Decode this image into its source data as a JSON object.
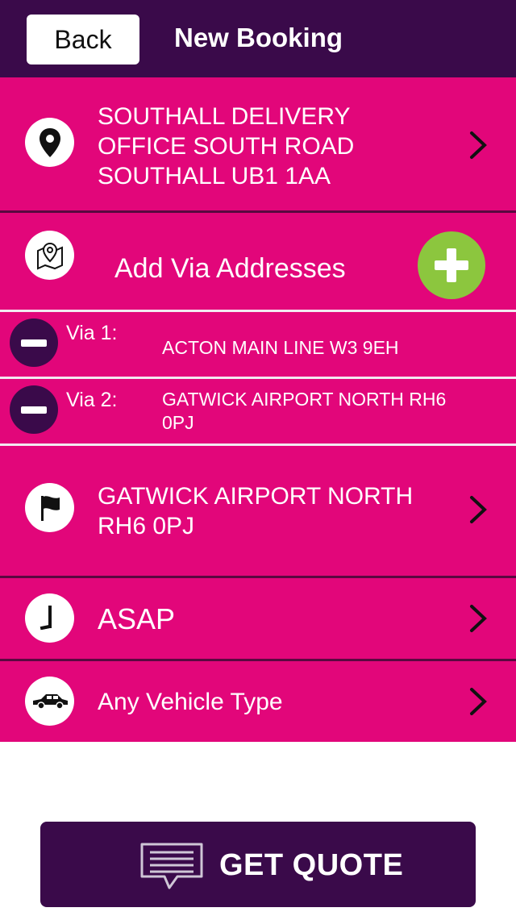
{
  "header": {
    "back_label": "Back",
    "title": "New Booking"
  },
  "pickup": {
    "icon": "location-pin-icon",
    "lines": [
      "SOUTHALL DELIVERY",
      "OFFICE SOUTH ROAD",
      "SOUTHALL UB1 1AA"
    ]
  },
  "via": {
    "icon": "map-pin-icon",
    "add_label": "Add Via Addresses",
    "items": [
      {
        "label": "Via 1:",
        "address_lines": [
          "ACTON MAIN LINE W3 9EH"
        ]
      },
      {
        "label": "Via 2:",
        "address_lines": [
          "GATWICK AIRPORT NORTH RH6",
          "0PJ"
        ]
      }
    ]
  },
  "dropoff": {
    "icon": "flag-icon",
    "lines": [
      "GATWICK AIRPORT NORTH",
      "RH6 0PJ"
    ]
  },
  "time": {
    "icon": "clock-icon",
    "label": "ASAP"
  },
  "vehicle": {
    "icon": "car-icon",
    "label": "Any Vehicle Type"
  },
  "footer": {
    "icon": "message-icon",
    "quote_label": "GET QUOTE"
  },
  "colors": {
    "header_bg": "#3a0a4a",
    "row_bg": "#e2067a",
    "add_button": "#8cc63e"
  }
}
